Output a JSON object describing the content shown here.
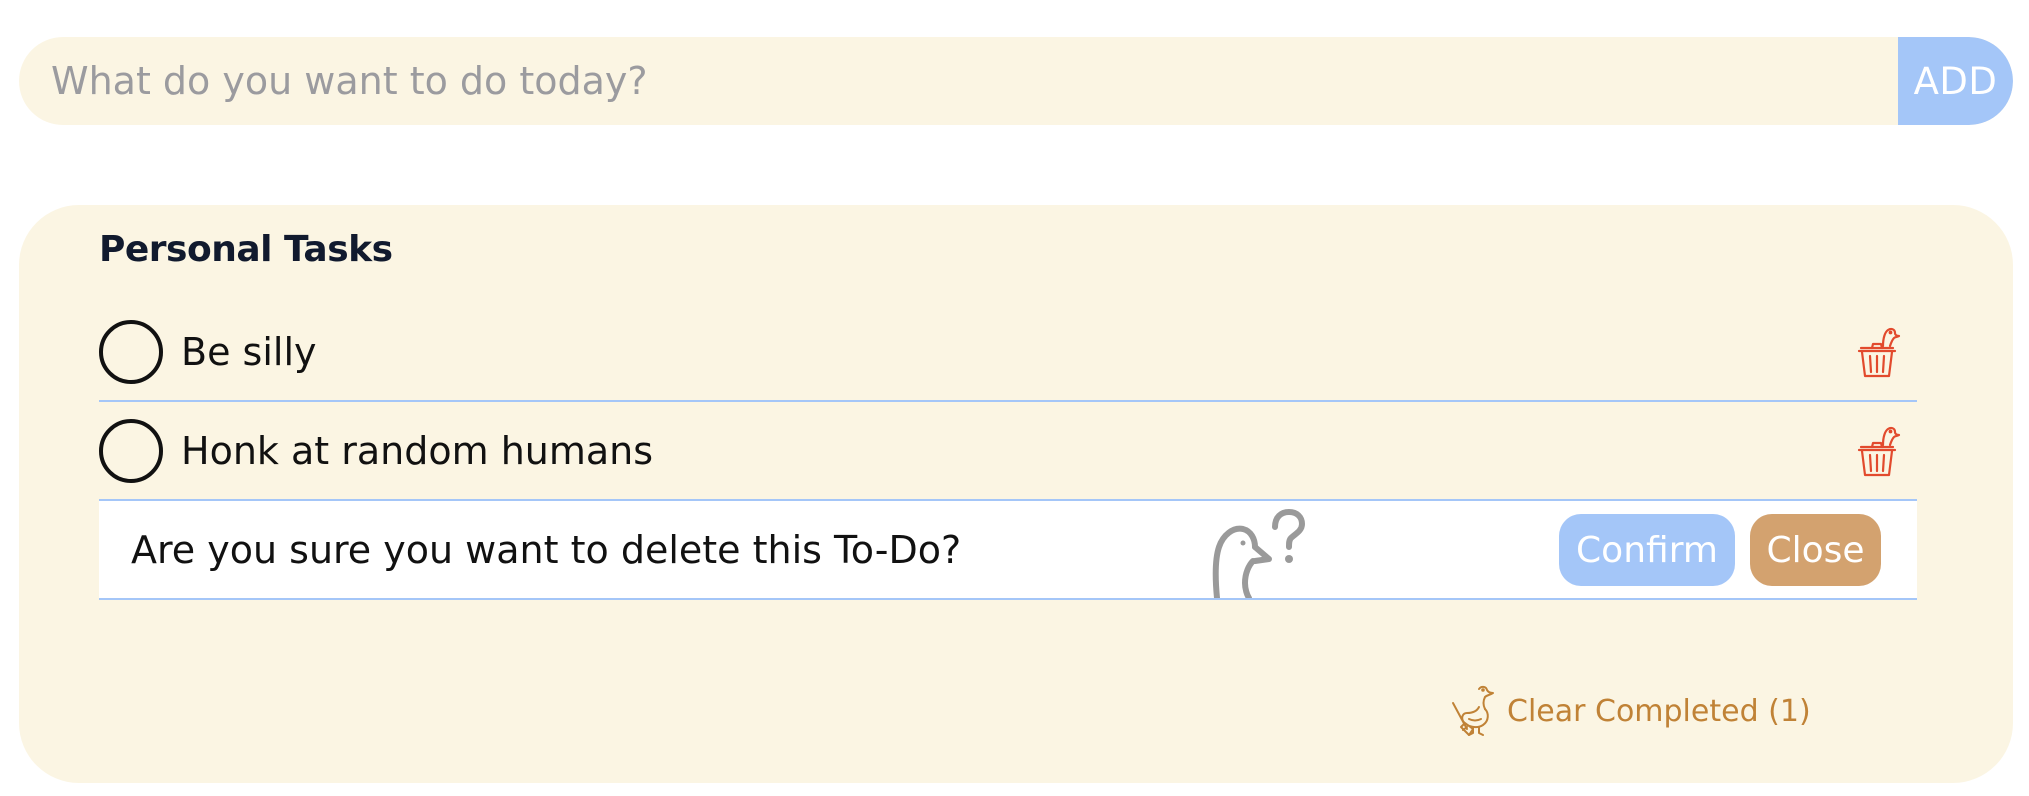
{
  "add_bar": {
    "placeholder": "What do you want to do today?",
    "value": "",
    "button_label": "ADD"
  },
  "list": {
    "title": "Personal Tasks",
    "tasks": [
      {
        "label": "Be silly",
        "completed": false
      },
      {
        "label": "Honk at random humans",
        "completed": false
      }
    ],
    "delete_confirm": {
      "message": "Are you sure you want to delete this To-Do?",
      "confirm_label": "Confirm",
      "close_label": "Close"
    },
    "clear_completed_label": "Clear Completed (1)"
  },
  "icons": {
    "trash": "goose-trash-icon",
    "question_goose": "goose-question-icon",
    "clear_goose": "goose-broom-icon"
  },
  "colors": {
    "card_bg": "#fbf5e3",
    "accent_blue": "#a4c6f8",
    "accent_tan": "#d3a26f",
    "delete_red": "#e24a2d",
    "clear_text": "#c08236",
    "title_text": "#111a2e"
  }
}
